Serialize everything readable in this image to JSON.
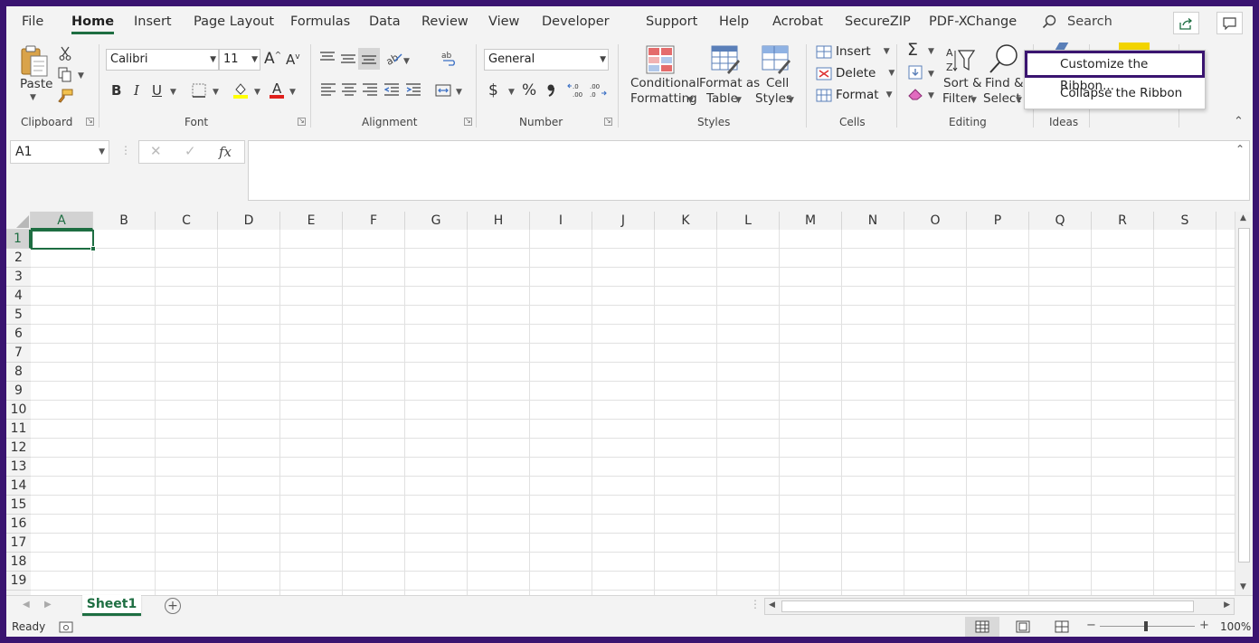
{
  "tabs": [
    "File",
    "Home",
    "Insert",
    "Page Layout",
    "Formulas",
    "Data",
    "Review",
    "View",
    "Developer",
    "Support",
    "Help",
    "Acrobat",
    "SecureZIP",
    "PDF-XChange"
  ],
  "active_tab": "Home",
  "search_label": "Search",
  "clipboard": {
    "paste": "Paste",
    "group": "Clipboard"
  },
  "font": {
    "name": "Calibri",
    "size": "11",
    "group": "Font",
    "bold": "B",
    "italic": "I",
    "underline": "U"
  },
  "alignment": {
    "group": "Alignment"
  },
  "number": {
    "format": "General",
    "group": "Number",
    "currency": "$",
    "percent": "%"
  },
  "styles": {
    "conditional_1": "Conditional",
    "conditional_2": "Formatting",
    "table_1": "Format as",
    "table_2": "Table",
    "cell_1": "Cell",
    "cell_2": "Styles",
    "group": "Styles"
  },
  "cells": {
    "insert": "Insert",
    "delete": "Delete",
    "format": "Format",
    "group": "Cells"
  },
  "editing": {
    "sort_1": "Sort &",
    "sort_2": "Filter",
    "find_1": "Find &",
    "find_2": "Select",
    "group": "Editing"
  },
  "ideas": {
    "group": "Ideas"
  },
  "context_menu": {
    "customize": "Customize the Ribbon...",
    "collapse": "Collapse the Ribbon"
  },
  "formula_bar": {
    "name_box": "A1",
    "fx": "fx",
    "value": ""
  },
  "columns": [
    "A",
    "B",
    "C",
    "D",
    "E",
    "F",
    "G",
    "H",
    "I",
    "J",
    "K",
    "L",
    "M",
    "N",
    "O",
    "P",
    "Q",
    "R",
    "S"
  ],
  "rows": [
    "1",
    "2",
    "3",
    "4",
    "5",
    "6",
    "7",
    "8",
    "9",
    "10",
    "11",
    "12",
    "13",
    "14",
    "15",
    "16",
    "17",
    "18",
    "19"
  ],
  "selected_cell": "A1",
  "sheet_tab": "Sheet1",
  "status": {
    "ready": "Ready",
    "zoom": "100%"
  },
  "colors": {
    "accent": "#1e6e42",
    "frame": "#3a1470"
  }
}
